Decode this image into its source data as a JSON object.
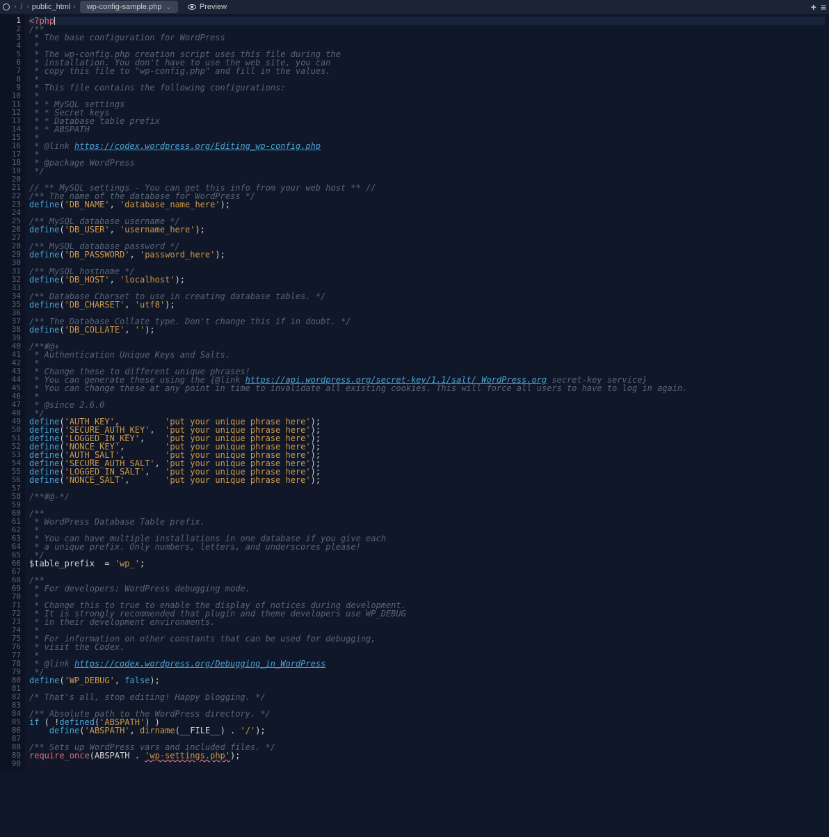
{
  "topbar": {
    "root_sep": "/",
    "folder": "public_html",
    "tab_file": "wp-config-sample.php",
    "preview": "Preview"
  },
  "lines": [
    [
      [
        "tag",
        "<?php"
      ]
    ],
    [
      [
        "comment",
        "/**"
      ]
    ],
    [
      [
        "comment",
        " * The base configuration for WordPress"
      ]
    ],
    [
      [
        "comment",
        " *"
      ]
    ],
    [
      [
        "comment",
        " * The wp-config.php creation script uses this file during the"
      ]
    ],
    [
      [
        "comment",
        " * installation. You don't have to use the web site, you can"
      ]
    ],
    [
      [
        "comment",
        " * copy this file to \"wp-config.php\" and fill in the values."
      ]
    ],
    [
      [
        "comment",
        " *"
      ]
    ],
    [
      [
        "comment",
        " * This file contains the following configurations:"
      ]
    ],
    [
      [
        "comment",
        " *"
      ]
    ],
    [
      [
        "comment",
        " * * MySQL settings"
      ]
    ],
    [
      [
        "comment",
        " * * Secret keys"
      ]
    ],
    [
      [
        "comment",
        " * * Database table prefix"
      ]
    ],
    [
      [
        "comment",
        " * * ABSPATH"
      ]
    ],
    [
      [
        "comment",
        " *"
      ]
    ],
    [
      [
        "comment",
        " * @link "
      ],
      [
        "link",
        "https://codex.wordpress.org/Editing_wp-config.php"
      ]
    ],
    [
      [
        "comment",
        " *"
      ]
    ],
    [
      [
        "comment",
        " * @package WordPress"
      ]
    ],
    [
      [
        "comment",
        " */"
      ]
    ],
    [],
    [
      [
        "comment",
        "// ** MySQL settings - You can get this info from your web host ** //"
      ]
    ],
    [
      [
        "comment",
        "/** The name of the database for WordPress */"
      ]
    ],
    [
      [
        "def",
        "define"
      ],
      [
        "paren",
        "("
      ],
      [
        "str",
        "'DB_NAME'"
      ],
      [
        "paren",
        ", "
      ],
      [
        "str",
        "'database_name_here'"
      ],
      [
        "paren",
        ");"
      ]
    ],
    [],
    [
      [
        "comment",
        "/** MySQL database username */"
      ]
    ],
    [
      [
        "def",
        "define"
      ],
      [
        "paren",
        "("
      ],
      [
        "str",
        "'DB_USER'"
      ],
      [
        "paren",
        ", "
      ],
      [
        "str",
        "'username_here'"
      ],
      [
        "paren",
        ");"
      ]
    ],
    [],
    [
      [
        "comment",
        "/** MySQL database password */"
      ]
    ],
    [
      [
        "def",
        "define"
      ],
      [
        "paren",
        "("
      ],
      [
        "str",
        "'DB_PASSWORD'"
      ],
      [
        "paren",
        ", "
      ],
      [
        "str",
        "'password_here'"
      ],
      [
        "paren",
        ");"
      ]
    ],
    [],
    [
      [
        "comment",
        "/** MySQL hostname */"
      ]
    ],
    [
      [
        "def",
        "define"
      ],
      [
        "paren",
        "("
      ],
      [
        "str",
        "'DB_HOST'"
      ],
      [
        "paren",
        ", "
      ],
      [
        "str",
        "'localhost'"
      ],
      [
        "paren",
        ");"
      ]
    ],
    [],
    [
      [
        "comment",
        "/** Database Charset to use in creating database tables. */"
      ]
    ],
    [
      [
        "def",
        "define"
      ],
      [
        "paren",
        "("
      ],
      [
        "str",
        "'DB_CHARSET'"
      ],
      [
        "paren",
        ", "
      ],
      [
        "str",
        "'utf8'"
      ],
      [
        "paren",
        ");"
      ]
    ],
    [],
    [
      [
        "comment",
        "/** The Database Collate type. Don't change this if in doubt. */"
      ]
    ],
    [
      [
        "def",
        "define"
      ],
      [
        "paren",
        "("
      ],
      [
        "str",
        "'DB_COLLATE'"
      ],
      [
        "paren",
        ", "
      ],
      [
        "str",
        "''"
      ],
      [
        "paren",
        ");"
      ]
    ],
    [],
    [
      [
        "comment",
        "/**#@+"
      ]
    ],
    [
      [
        "comment",
        " * Authentication Unique Keys and Salts."
      ]
    ],
    [
      [
        "comment",
        " *"
      ]
    ],
    [
      [
        "comment",
        " * Change these to different unique phrases!"
      ]
    ],
    [
      [
        "comment",
        " * You can generate these using the {@link "
      ],
      [
        "link",
        "https://api.wordpress.org/secret-key/1.1/salt/ WordPress.org"
      ],
      [
        "comment",
        " secret-key service}"
      ]
    ],
    [
      [
        "comment",
        " * You can change these at any point in time to invalidate all existing cookies. This will force all users to have to log in again."
      ]
    ],
    [
      [
        "comment",
        " *"
      ]
    ],
    [
      [
        "comment",
        " * @since 2.6.0"
      ]
    ],
    [
      [
        "comment",
        " */"
      ]
    ],
    [
      [
        "def",
        "define"
      ],
      [
        "paren",
        "("
      ],
      [
        "str",
        "'AUTH_KEY'"
      ],
      [
        "paren",
        ",         "
      ],
      [
        "str",
        "'put your unique phrase here'"
      ],
      [
        "paren",
        ");"
      ]
    ],
    [
      [
        "def",
        "define"
      ],
      [
        "paren",
        "("
      ],
      [
        "str",
        "'SECURE_AUTH_KEY'"
      ],
      [
        "paren",
        ",  "
      ],
      [
        "str",
        "'put your unique phrase here'"
      ],
      [
        "paren",
        ");"
      ]
    ],
    [
      [
        "def",
        "define"
      ],
      [
        "paren",
        "("
      ],
      [
        "str",
        "'LOGGED_IN_KEY'"
      ],
      [
        "paren",
        ",    "
      ],
      [
        "str",
        "'put your unique phrase here'"
      ],
      [
        "paren",
        ");"
      ]
    ],
    [
      [
        "def",
        "define"
      ],
      [
        "paren",
        "("
      ],
      [
        "str",
        "'NONCE_KEY'"
      ],
      [
        "paren",
        ",        "
      ],
      [
        "str",
        "'put your unique phrase here'"
      ],
      [
        "paren",
        ");"
      ]
    ],
    [
      [
        "def",
        "define"
      ],
      [
        "paren",
        "("
      ],
      [
        "str",
        "'AUTH_SALT'"
      ],
      [
        "paren",
        ",        "
      ],
      [
        "str",
        "'put your unique phrase here'"
      ],
      [
        "paren",
        ");"
      ]
    ],
    [
      [
        "def",
        "define"
      ],
      [
        "paren",
        "("
      ],
      [
        "str",
        "'SECURE_AUTH_SALT'"
      ],
      [
        "paren",
        ", "
      ],
      [
        "str",
        "'put your unique phrase here'"
      ],
      [
        "paren",
        ");"
      ]
    ],
    [
      [
        "def",
        "define"
      ],
      [
        "paren",
        "("
      ],
      [
        "str",
        "'LOGGED_IN_SALT'"
      ],
      [
        "paren",
        ",   "
      ],
      [
        "str",
        "'put your unique phrase here'"
      ],
      [
        "paren",
        ");"
      ]
    ],
    [
      [
        "def",
        "define"
      ],
      [
        "paren",
        "("
      ],
      [
        "str",
        "'NONCE_SALT'"
      ],
      [
        "paren",
        ",       "
      ],
      [
        "str",
        "'put your unique phrase here'"
      ],
      [
        "paren",
        ");"
      ]
    ],
    [],
    [
      [
        "comment",
        "/**#@-*/"
      ]
    ],
    [],
    [
      [
        "comment",
        "/**"
      ]
    ],
    [
      [
        "comment",
        " * WordPress Database Table prefix."
      ]
    ],
    [
      [
        "comment",
        " *"
      ]
    ],
    [
      [
        "comment",
        " * You can have multiple installations in one database if you give each"
      ]
    ],
    [
      [
        "comment",
        " * a unique prefix. Only numbers, letters, and underscores please!"
      ]
    ],
    [
      [
        "comment",
        " */"
      ]
    ],
    [
      [
        "var",
        "$table_prefix  "
      ],
      [
        "paren",
        "= "
      ],
      [
        "str",
        "'wp_'"
      ],
      [
        "paren",
        ";"
      ]
    ],
    [],
    [
      [
        "comment",
        "/**"
      ]
    ],
    [
      [
        "comment",
        " * For developers: WordPress debugging mode."
      ]
    ],
    [
      [
        "comment",
        " *"
      ]
    ],
    [
      [
        "comment",
        " * Change this to true to enable the display of notices during development."
      ]
    ],
    [
      [
        "comment",
        " * It is strongly recommended that plugin and theme developers use WP_DEBUG"
      ]
    ],
    [
      [
        "comment",
        " * in their development environments."
      ]
    ],
    [
      [
        "comment",
        " *"
      ]
    ],
    [
      [
        "comment",
        " * For information on other constants that can be used for debugging,"
      ]
    ],
    [
      [
        "comment",
        " * visit the Codex."
      ]
    ],
    [
      [
        "comment",
        " *"
      ]
    ],
    [
      [
        "comment",
        " * @link "
      ],
      [
        "link",
        "https://codex.wordpress.org/Debugging_in_WordPress"
      ]
    ],
    [
      [
        "comment",
        " */"
      ]
    ],
    [
      [
        "def",
        "define"
      ],
      [
        "paren",
        "("
      ],
      [
        "str",
        "'WP_DEBUG'"
      ],
      [
        "paren",
        ", "
      ],
      [
        "bool",
        "false"
      ],
      [
        "paren",
        ");"
      ]
    ],
    [],
    [
      [
        "comment",
        "/* That's all, stop editing! Happy blogging. */"
      ]
    ],
    [],
    [
      [
        "comment",
        "/** Absolute path to the WordPress directory. */"
      ]
    ],
    [
      [
        "kw",
        "if"
      ],
      [
        "paren",
        " ( !"
      ],
      [
        "def",
        "defined"
      ],
      [
        "paren",
        "("
      ],
      [
        "str",
        "'ABSPATH'"
      ],
      [
        "paren",
        ") )"
      ]
    ],
    [
      [
        "paren",
        "    "
      ],
      [
        "def",
        "define"
      ],
      [
        "paren",
        "("
      ],
      [
        "str",
        "'ABSPATH'"
      ],
      [
        "paren",
        ", "
      ],
      [
        "fn",
        "dirname"
      ],
      [
        "paren",
        "("
      ],
      [
        "var",
        "__FILE__"
      ],
      [
        "paren",
        ") . "
      ],
      [
        "str",
        "'/'"
      ],
      [
        "paren",
        ");"
      ]
    ],
    [],
    [
      [
        "comment",
        "/** Sets up WordPress vars and included files. */"
      ]
    ],
    [
      [
        "req",
        "require_once"
      ],
      [
        "paren",
        "("
      ],
      [
        "var",
        "ABSPATH "
      ],
      [
        "paren",
        ". "
      ],
      [
        "err",
        "'wp-settings.php'"
      ],
      [
        "paren",
        ");"
      ]
    ],
    []
  ],
  "current_line": 1
}
